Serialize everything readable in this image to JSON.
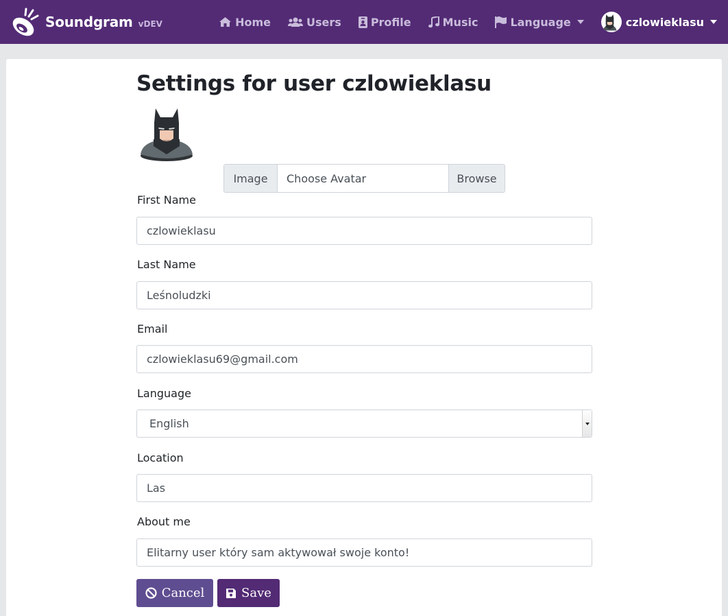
{
  "brand": {
    "name": "Soundgram",
    "version": "vDEV"
  },
  "nav": {
    "home": "Home",
    "users": "Users",
    "profile": "Profile",
    "music": "Music",
    "language": "Language",
    "user": "czlowieklasu"
  },
  "page": {
    "title": "Settings for user czlowieklasu"
  },
  "avatar_upload": {
    "prefix": "Image",
    "placeholder": "Choose Avatar",
    "browse": "Browse"
  },
  "form": {
    "first_name": {
      "label": "First Name",
      "value": "czlowieklasu"
    },
    "last_name": {
      "label": "Last Name",
      "value": "Leśnoludzki"
    },
    "email": {
      "label": "Email",
      "value": "czlowieklasu69@gmail.com"
    },
    "language": {
      "label": "Language",
      "value": "English"
    },
    "location": {
      "label": "Location",
      "value": "Las"
    },
    "about": {
      "label": "About me",
      "value": "Elitarny user który sam aktywował swoje konto!"
    }
  },
  "buttons": {
    "cancel": "Cancel",
    "save": "Save"
  },
  "colors": {
    "navbar": "#532b75",
    "cancel": "#5f4d91",
    "save": "#532b75",
    "background": "#e6e7e9"
  }
}
